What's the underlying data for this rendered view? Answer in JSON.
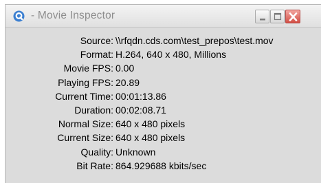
{
  "window": {
    "title": "- Movie Inspector",
    "controls": {
      "minimize_icon": "minimize-icon",
      "maximize_icon": "maximize-icon",
      "close_icon": "close-icon"
    },
    "app_icon": "quicktime-icon"
  },
  "colors": {
    "title_text": "#8d8d8d",
    "window_bg": "#dcdcdc",
    "close_button": "#d24f45",
    "app_icon": "#3b7fd1"
  },
  "info": [
    {
      "label": "Source:",
      "value": "\\\\rfqdn.cds.com\\test_prepos\\test.mov"
    },
    {
      "label": "Format:",
      "value": "H.264, 640 x 480, Millions"
    },
    {
      "label": "Movie FPS:",
      "value": "0.00"
    },
    {
      "label": "Playing FPS:",
      "value": "20.89"
    },
    {
      "label": "Current Time:",
      "value": "00:01:13.86"
    },
    {
      "label": "Duration:",
      "value": "00:02:08.71"
    },
    {
      "label": "Normal Size:",
      "value": "640 x 480 pixels"
    },
    {
      "label": "Current Size:",
      "value": "640 x 480 pixels"
    },
    {
      "label": "Quality:",
      "value": "Unknown"
    },
    {
      "label": "Bit Rate:",
      "value": "864.929688 kbits/sec"
    }
  ]
}
